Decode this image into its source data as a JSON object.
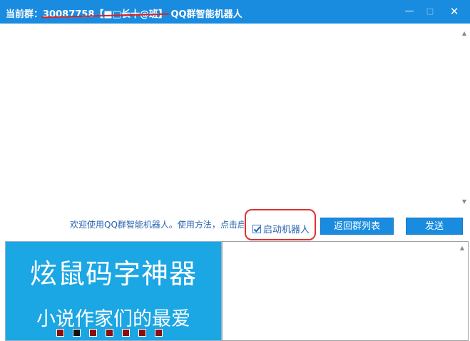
{
  "window": {
    "title_prefix": "当前群：",
    "title_redacted": "30087758【■□长十@班】",
    "title_suffix": "QQ群智能机器人",
    "minimize_glyph": "—",
    "maximize_glyph": "□",
    "close_glyph": "✕"
  },
  "scrollbar": {
    "up_glyph": "▲",
    "down_glyph": "▼"
  },
  "controls": {
    "welcome_text": "欢迎使用QQ群智能机器人。使用方法，点击启",
    "robot_checkbox_label": "启动机器人",
    "robot_checkbox_checked": true,
    "back_button_label": "返回群列表",
    "send_button_label": "发送"
  },
  "banner": {
    "title": "炫鼠码字神器",
    "subtitle": "小说作家们的最爱",
    "background": "#1ba6e4",
    "indicator_colors": [
      "#8b0d0d",
      "#111111",
      "#8b0d0d",
      "#8b0d0d",
      "#8b0d0d",
      "#8b0d0d",
      "#8b0d0d"
    ],
    "active_index": 1
  },
  "colors": {
    "accent": "#1a8ce0",
    "highlight_ring": "#e03030"
  }
}
